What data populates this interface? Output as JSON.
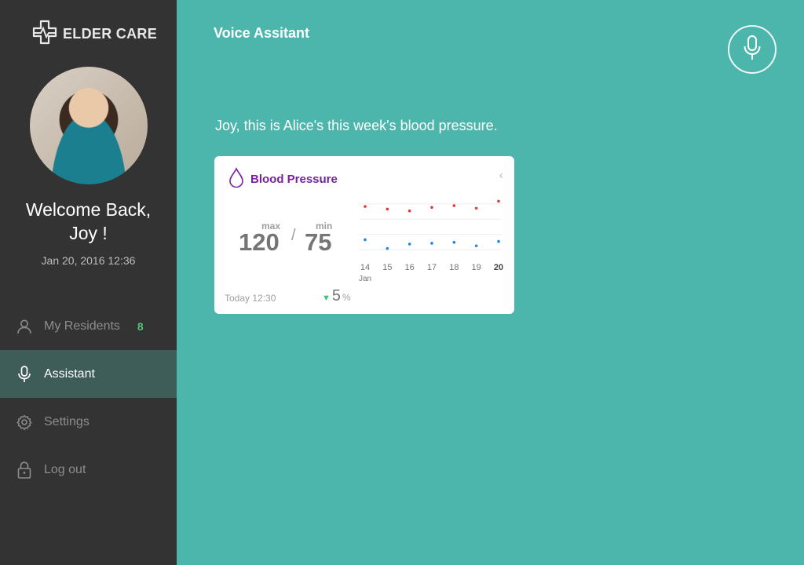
{
  "app": {
    "logo_text": "ELDER CARE"
  },
  "sidebar": {
    "welcome_line1": "Welcome Back,",
    "welcome_line2": "Joy !",
    "datetime": "Jan 20, 2016  12:36",
    "items": [
      {
        "label": "My Residents",
        "badge": "8",
        "icon": "user-icon"
      },
      {
        "label": "Assistant",
        "icon": "microphone-icon",
        "active": true
      },
      {
        "label": "Settings",
        "icon": "gear-icon"
      },
      {
        "label": "Log out",
        "icon": "lock-icon"
      }
    ]
  },
  "main": {
    "title": "Voice Assitant",
    "message": "Joy, this is Alice's this week's blood pressure."
  },
  "card": {
    "title": "Blood Pressure",
    "max_label": "max",
    "min_label": "min",
    "max_value": "120",
    "separator": "/",
    "min_value": "75",
    "timestamp": "Today 12:30",
    "delta_value": "5",
    "delta_unit": "%"
  },
  "colors": {
    "accent": "#4db6ac",
    "sidebar": "#333333",
    "active": "#3f5d58",
    "title_purple": "#7b1fa2",
    "max_dot": "#e53935",
    "min_dot": "#1e88e5",
    "badge": "#55c37a"
  },
  "chart_data": {
    "type": "scatter",
    "categories": [
      "14",
      "15",
      "16",
      "17",
      "18",
      "19",
      "20"
    ],
    "month_label": "Jan",
    "highlight_category": "20",
    "series": [
      {
        "name": "max",
        "values": [
          120,
          117,
          115,
          119,
          121,
          118,
          126
        ]
      },
      {
        "name": "min",
        "values": [
          82,
          72,
          77,
          78,
          79,
          75,
          80
        ]
      }
    ],
    "ylim": [
      60,
      130
    ],
    "grid": true
  }
}
